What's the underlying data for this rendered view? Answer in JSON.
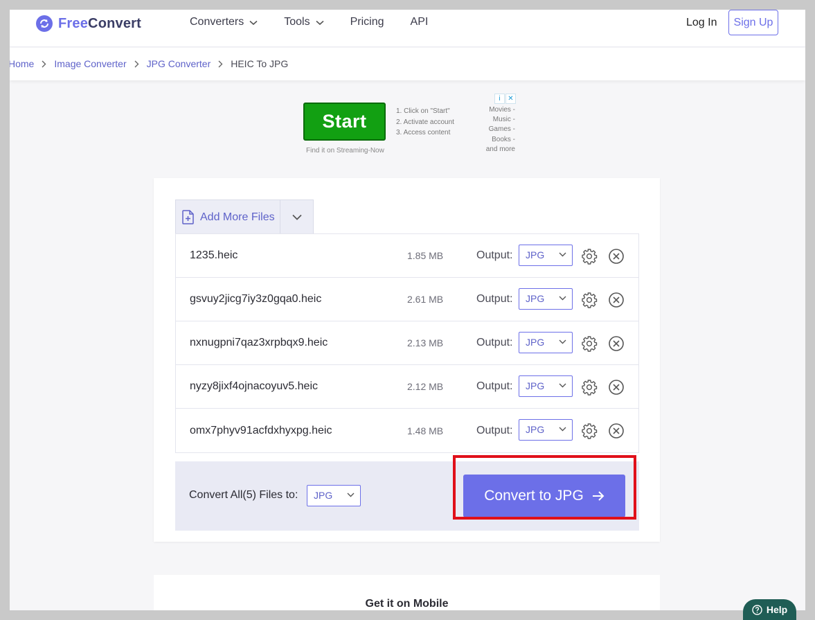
{
  "brand": {
    "name_part1": "Free",
    "name_part2": "Convert",
    "accent": "#6c6fe8"
  },
  "nav": {
    "items": [
      {
        "label": "Converters",
        "dropdown": true
      },
      {
        "label": "Tools",
        "dropdown": true
      },
      {
        "label": "Pricing",
        "dropdown": false
      },
      {
        "label": "API",
        "dropdown": false
      }
    ],
    "login": "Log In",
    "signup": "Sign Up"
  },
  "breadcrumb": [
    "Home",
    "Image Converter",
    "JPG Converter",
    "HEIC To JPG"
  ],
  "ad": {
    "button": "Start",
    "steps": [
      "1. Click on \"Start\"",
      "2. Activate account",
      "3. Access content"
    ],
    "side": [
      "Movies -",
      "Music -",
      "Games -",
      "Books -",
      "and more"
    ],
    "footer": "Find it on Streaming-Now"
  },
  "uploader": {
    "add_more": "Add More Files",
    "output_label": "Output:",
    "files": [
      {
        "name": "1235.heic",
        "size": "1.85 MB",
        "format": "JPG"
      },
      {
        "name": "gsvuy2jicg7iy3z0gqa0.heic",
        "size": "2.61 MB",
        "format": "JPG"
      },
      {
        "name": "nxnugpni7qaz3xrpbqx9.heic",
        "size": "2.13 MB",
        "format": "JPG"
      },
      {
        "name": "nyzy8jixf4ojnacoyuv5.heic",
        "size": "2.12 MB",
        "format": "JPG"
      },
      {
        "name": "omx7phyv91acfdxhyxpg.heic",
        "size": "1.48 MB",
        "format": "JPG"
      }
    ],
    "convert_all_label": "Convert All(5) Files to:",
    "convert_all_format": "JPG",
    "convert_button": "Convert to JPG"
  },
  "mobile": {
    "title": "Get it on Mobile"
  },
  "help": {
    "label": "Help"
  }
}
